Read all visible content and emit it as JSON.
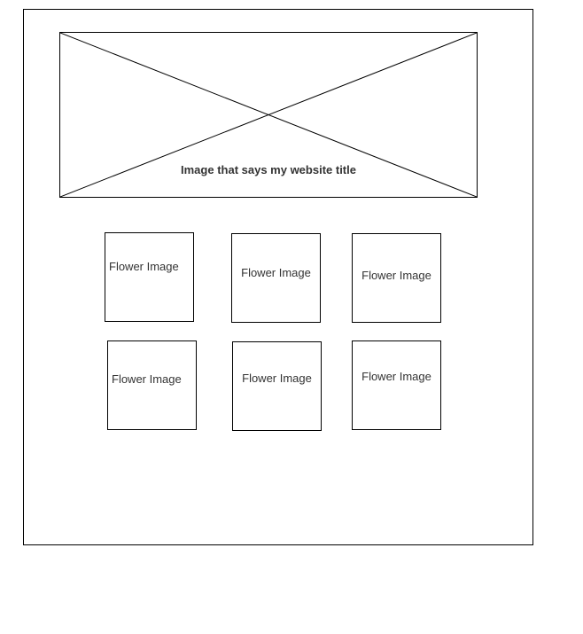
{
  "banner": {
    "label": "Image that says my website title"
  },
  "tiles": [
    {
      "label": "Flower Image"
    },
    {
      "label": "Flower Image"
    },
    {
      "label": "Flower Image"
    },
    {
      "label": "Flower Image"
    },
    {
      "label": "Flower Image"
    },
    {
      "label": "Flower Image"
    }
  ]
}
